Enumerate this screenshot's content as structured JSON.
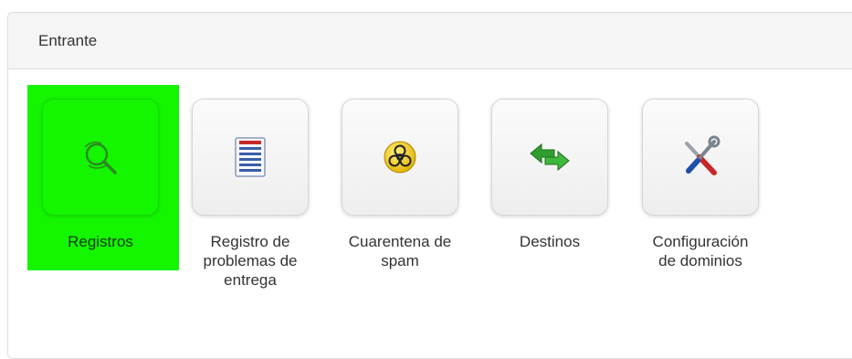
{
  "panel": {
    "title": "Entrante"
  },
  "tiles": [
    {
      "label": "Registros",
      "icon": "magnifier-icon",
      "active": true
    },
    {
      "label": "Registro de\nproblemas de\nentrega",
      "icon": "document-list-icon",
      "active": false
    },
    {
      "label": "Cuarentena de\nspam",
      "icon": "biohazard-icon",
      "active": false
    },
    {
      "label": "Destinos",
      "icon": "routing-arrows-icon",
      "active": false
    },
    {
      "label": "Configuración\nde dominios",
      "icon": "tools-icon",
      "active": false
    }
  ],
  "colors": {
    "highlight": "#14f500",
    "text": "#333333"
  }
}
